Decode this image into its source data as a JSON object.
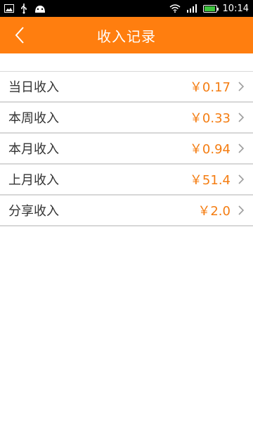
{
  "status_bar": {
    "time": "10:14",
    "icons": [
      "image-icon",
      "usb-icon",
      "android-icon",
      "wifi-icon",
      "signal-icon",
      "battery-icon"
    ]
  },
  "header": {
    "title": "收入记录",
    "back_icon": "chevron-left-icon",
    "background_color": "#ff7e0f"
  },
  "income_list": [
    {
      "label": "当日收入",
      "value": "￥0.17"
    },
    {
      "label": "本周收入",
      "value": "￥0.33"
    },
    {
      "label": "本月收入",
      "value": "￥0.94"
    },
    {
      "label": "上月收入",
      "value": "￥51.4"
    },
    {
      "label": "分享收入",
      "value": "￥2.0"
    }
  ],
  "colors": {
    "accent": "#ff7e0f",
    "value_text": "#f47d12",
    "label_text": "#333333"
  }
}
